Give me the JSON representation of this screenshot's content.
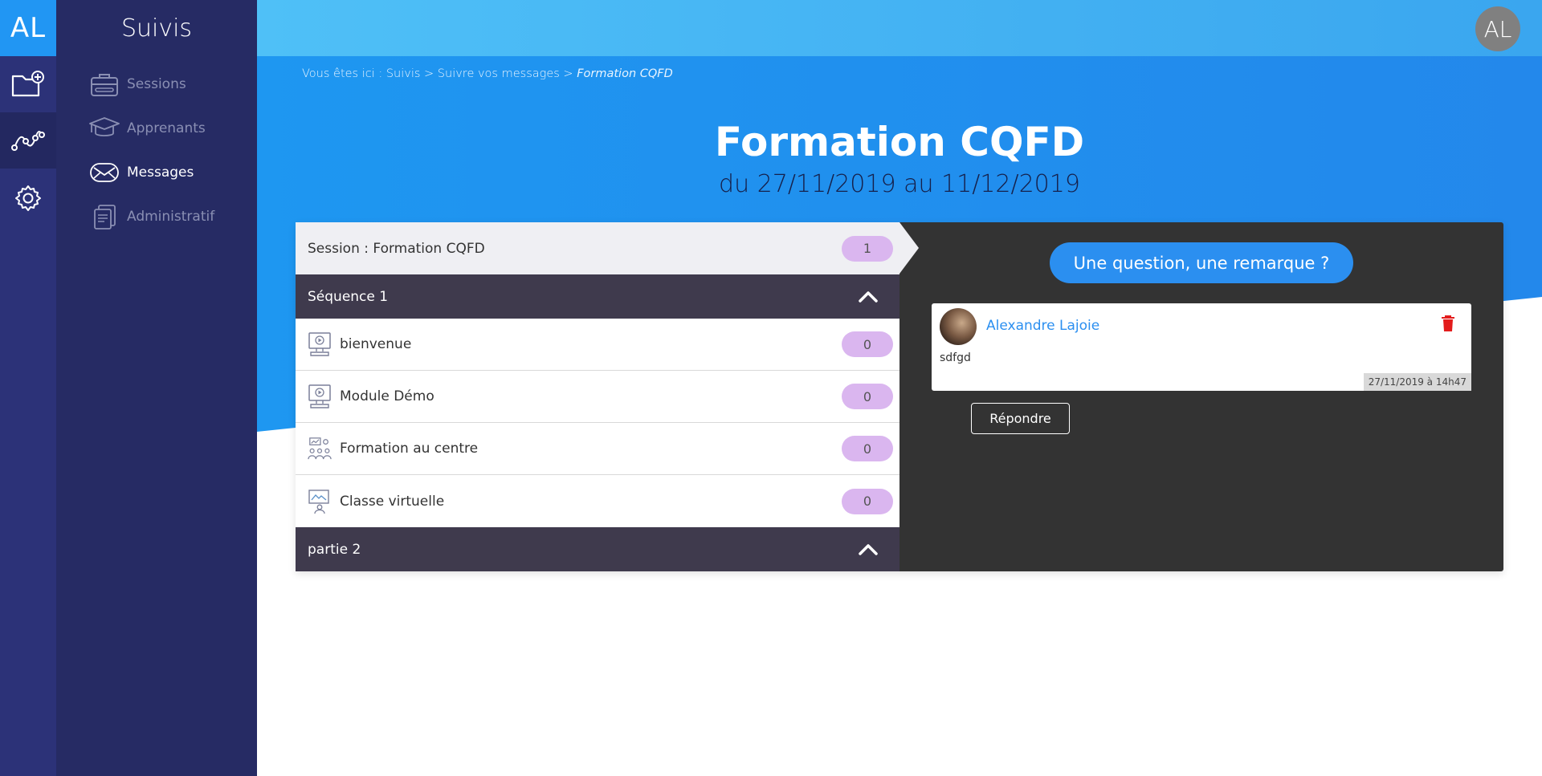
{
  "rail": {
    "logo": "AL",
    "items": [
      {
        "icon": "folder-add-icon"
      },
      {
        "icon": "tracking-graph-icon"
      },
      {
        "icon": "gear-icon"
      }
    ]
  },
  "menu": {
    "title": "Suivis",
    "items": [
      {
        "label": "Sessions",
        "icon": "sessions-icon"
      },
      {
        "label": "Apprenants",
        "icon": "graduation-cap-icon"
      },
      {
        "label": "Messages",
        "icon": "envelope-icon",
        "active": true
      },
      {
        "label": "Administratif",
        "icon": "documents-icon"
      }
    ]
  },
  "header": {
    "user_initials": "AL",
    "breadcrumb_prefix": "Vous êtes ici : Suivis > Suivre vos messages > ",
    "breadcrumb_current": "Formation CQFD",
    "title": "Formation CQFD",
    "subtitle": "du 27/11/2019 au 11/12/2019"
  },
  "session": {
    "label": "Session : Formation CQFD",
    "count": "1"
  },
  "sequences": [
    {
      "title": "Séquence 1",
      "modules": [
        {
          "label": "bienvenue",
          "count": "0",
          "icon": "video-screen-icon"
        },
        {
          "label": "Module Démo",
          "count": "0",
          "icon": "video-screen-icon"
        },
        {
          "label": "Formation au centre",
          "count": "0",
          "icon": "group-training-icon"
        },
        {
          "label": "Classe virtuelle",
          "count": "0",
          "icon": "virtual-class-icon"
        }
      ]
    },
    {
      "title": "partie 2",
      "modules": []
    }
  ],
  "chat": {
    "ask_label": "Une question, une remarque ?",
    "message": {
      "author": "Alexandre Lajoie",
      "text": "sdfgd",
      "date": "27/11/2019 à 14h47"
    },
    "reply_label": "Répondre"
  },
  "colors": {
    "rail": "#2c3278",
    "menu": "#262b64",
    "accent": "#2196f3",
    "badge": "#dab6ef",
    "sequence_header": "#3f3a4d",
    "chat_panel": "#333333",
    "delete": "#e31c1c"
  }
}
